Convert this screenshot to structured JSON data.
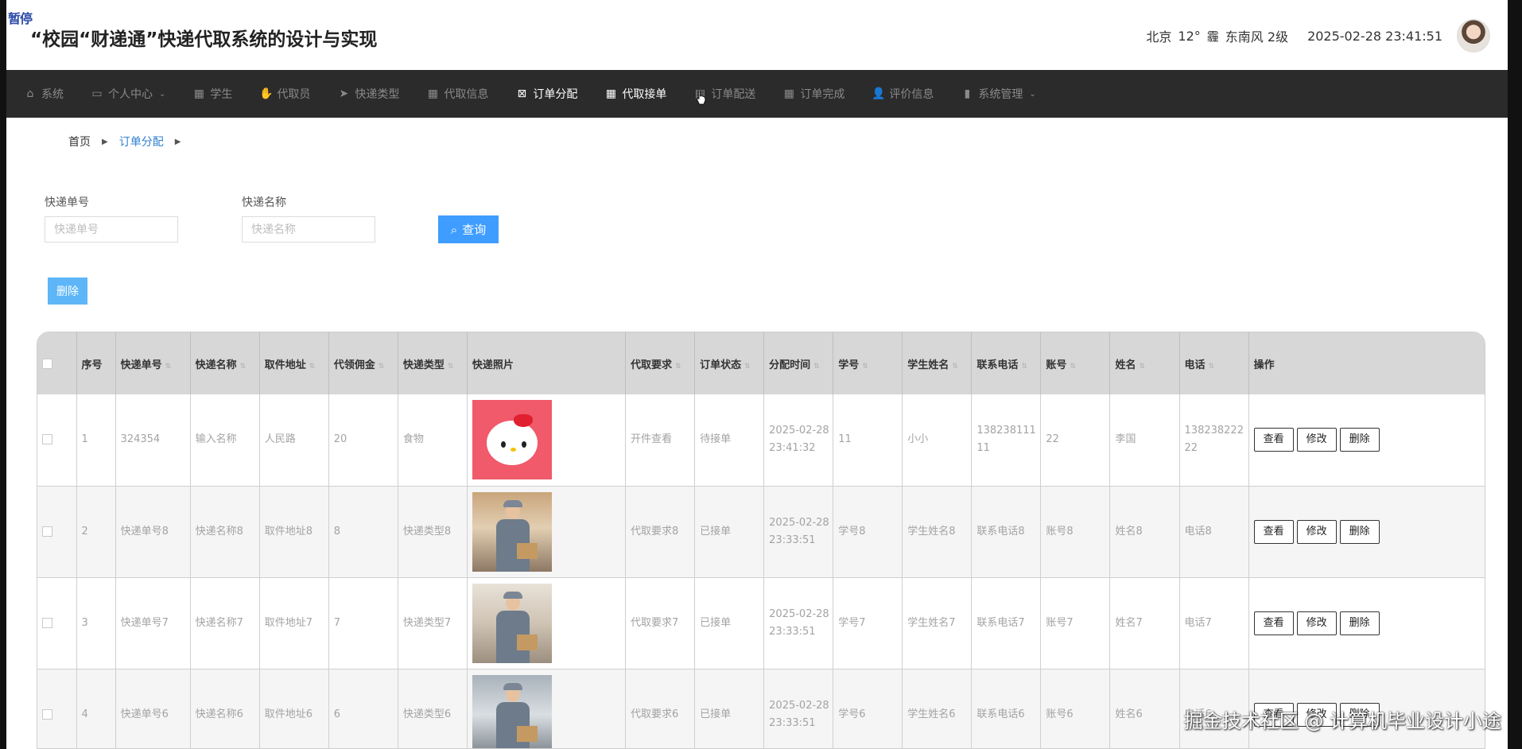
{
  "pause_tag": "暂停",
  "header": {
    "title": "“校园“财递通”快递代取系统的设计与实现",
    "weather_city": "北京",
    "weather_temp": "12°",
    "weather_icon": "霾",
    "weather_wind": "东南风 2级",
    "datetime": "2025-02-28 23:41:51"
  },
  "nav": {
    "items": [
      {
        "label": "系统",
        "icon": "⌂"
      },
      {
        "label": "个人中心",
        "icon": "▭",
        "caret": "⌄"
      },
      {
        "label": "学生",
        "icon": "▦"
      },
      {
        "label": "代取员",
        "icon": "✋"
      },
      {
        "label": "快递类型",
        "icon": "➤"
      },
      {
        "label": "代取信息",
        "icon": "▦"
      },
      {
        "label": "订单分配",
        "icon": "⊠"
      },
      {
        "label": "代取接单",
        "icon": "▦"
      },
      {
        "label": "订单配送",
        "icon": "▤"
      },
      {
        "label": "订单完成",
        "icon": "▦"
      },
      {
        "label": "评价信息",
        "icon": "👤"
      },
      {
        "label": "系统管理",
        "icon": "▮",
        "caret": "⌄"
      }
    ]
  },
  "breadcrumb": {
    "home": "首页",
    "current": "订单分配",
    "sep": "▶"
  },
  "filters": {
    "express_no_label": "快递单号",
    "express_no_placeholder": "快递单号",
    "express_name_label": "快递名称",
    "express_name_placeholder": "快递名称",
    "query_label": "查询",
    "query_icon": "⌕"
  },
  "delete_label": "删除",
  "sort_icon": "⇅",
  "table": {
    "headers": [
      "序号",
      "快递单号",
      "快递名称",
      "取件地址",
      "代领佣金",
      "快递类型",
      "快递照片",
      "代取要求",
      "订单状态",
      "分配时间",
      "学号",
      "学生姓名",
      "联系电话",
      "账号",
      "姓名",
      "电话",
      "操作"
    ],
    "rows": [
      {
        "no": "1",
        "express_no": "324354",
        "name": "输入名称",
        "address": "人民路",
        "fee": "20",
        "type": "食物",
        "photo": "kitty",
        "req": "开件查看",
        "status": "待接单",
        "time_date": "2025-02-28",
        "time_clock": "23:41:32",
        "student_no": "11",
        "student_name": "小小",
        "phone_a": "138238111",
        "phone_b": "11",
        "account": "22",
        "person": "李国",
        "tel_a": "138238222",
        "tel_b": "22"
      },
      {
        "no": "2",
        "express_no": "快递单号8",
        "name": "快递名称8",
        "address": "取件地址8",
        "fee": "8",
        "type": "快递类型8",
        "photo": "courier",
        "req": "代取要求8",
        "status": "已接单",
        "time_date": "2025-02-28",
        "time_clock": "23:33:51",
        "student_no": "学号8",
        "student_name": "学生姓名8",
        "phone_a": "联系电话8",
        "phone_b": "",
        "account": "账号8",
        "person": "姓名8",
        "tel_a": "电话8",
        "tel_b": ""
      },
      {
        "no": "3",
        "express_no": "快递单号7",
        "name": "快递名称7",
        "address": "取件地址7",
        "fee": "7",
        "type": "快递类型7",
        "photo": "courier",
        "req": "代取要求7",
        "status": "已接单",
        "time_date": "2025-02-28",
        "time_clock": "23:33:51",
        "student_no": "学号7",
        "student_name": "学生姓名7",
        "phone_a": "联系电话7",
        "phone_b": "",
        "account": "账号7",
        "person": "姓名7",
        "tel_a": "电话7",
        "tel_b": ""
      },
      {
        "no": "4",
        "express_no": "快递单号6",
        "name": "快递名称6",
        "address": "取件地址6",
        "fee": "6",
        "type": "快递类型6",
        "photo": "courier",
        "req": "代取要求6",
        "status": "已接单",
        "time_date": "2025-02-28",
        "time_clock": "23:33:51",
        "student_no": "学号6",
        "student_name": "学生姓名6",
        "phone_a": "联系电话6",
        "phone_b": "",
        "account": "账号6",
        "person": "姓名6",
        "tel_a": "电话6",
        "tel_b": ""
      }
    ],
    "actions": {
      "view": "查看",
      "edit": "修改",
      "delete": "删除"
    }
  },
  "watermark": "掘金技术社区 @ 计算机毕业设计小途"
}
